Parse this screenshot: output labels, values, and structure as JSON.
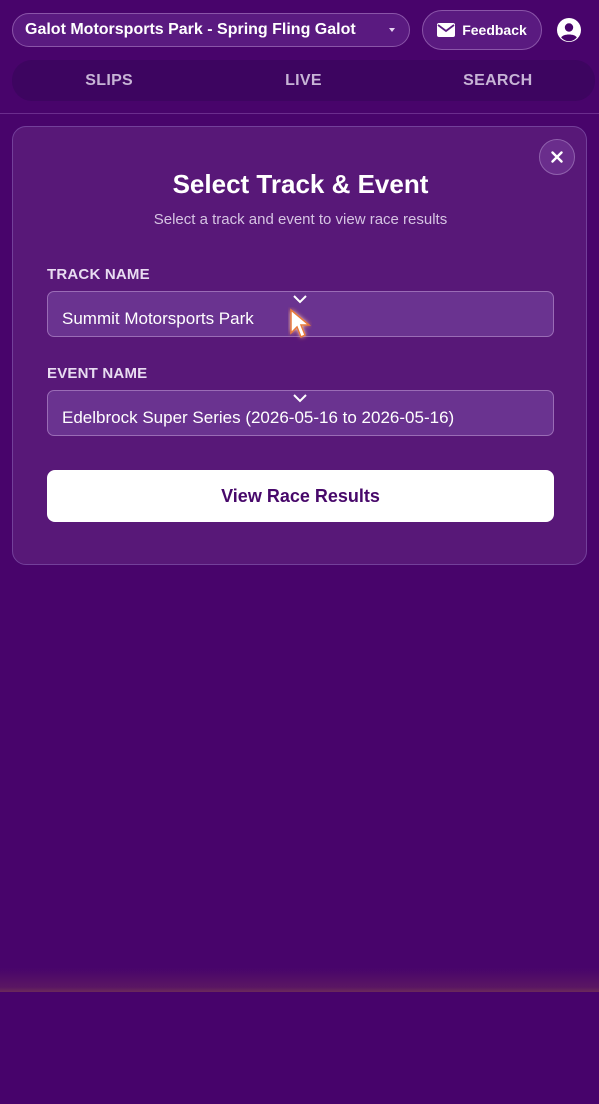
{
  "header": {
    "event_selector": "Galot Motorsports Park - Spring Fling Galot",
    "feedback_label": "Feedback"
  },
  "tabs": [
    {
      "label": "SLIPS"
    },
    {
      "label": "LIVE"
    },
    {
      "label": "SEARCH"
    }
  ],
  "modal": {
    "title": "Select Track & Event",
    "subtitle": "Select a track and event to view race results",
    "track_label": "TRACK NAME",
    "track_value": "Summit Motorsports Park",
    "event_label": "EVENT NAME",
    "event_value": "Edelbrock Super Series (2026-05-16 to 2026-05-16)",
    "submit_label": "View Race Results"
  },
  "icons": {
    "feedback": "mail-icon",
    "account": "user-circle-icon",
    "close": "close-icon",
    "dropdown": "chevron-down-icon",
    "cursor": "pointer-cursor-icon"
  },
  "colors": {
    "background": "#48046b",
    "card": "#581878",
    "tab_bar": "#3d0560",
    "button": "#ffffff",
    "button_text": "#47086a"
  }
}
